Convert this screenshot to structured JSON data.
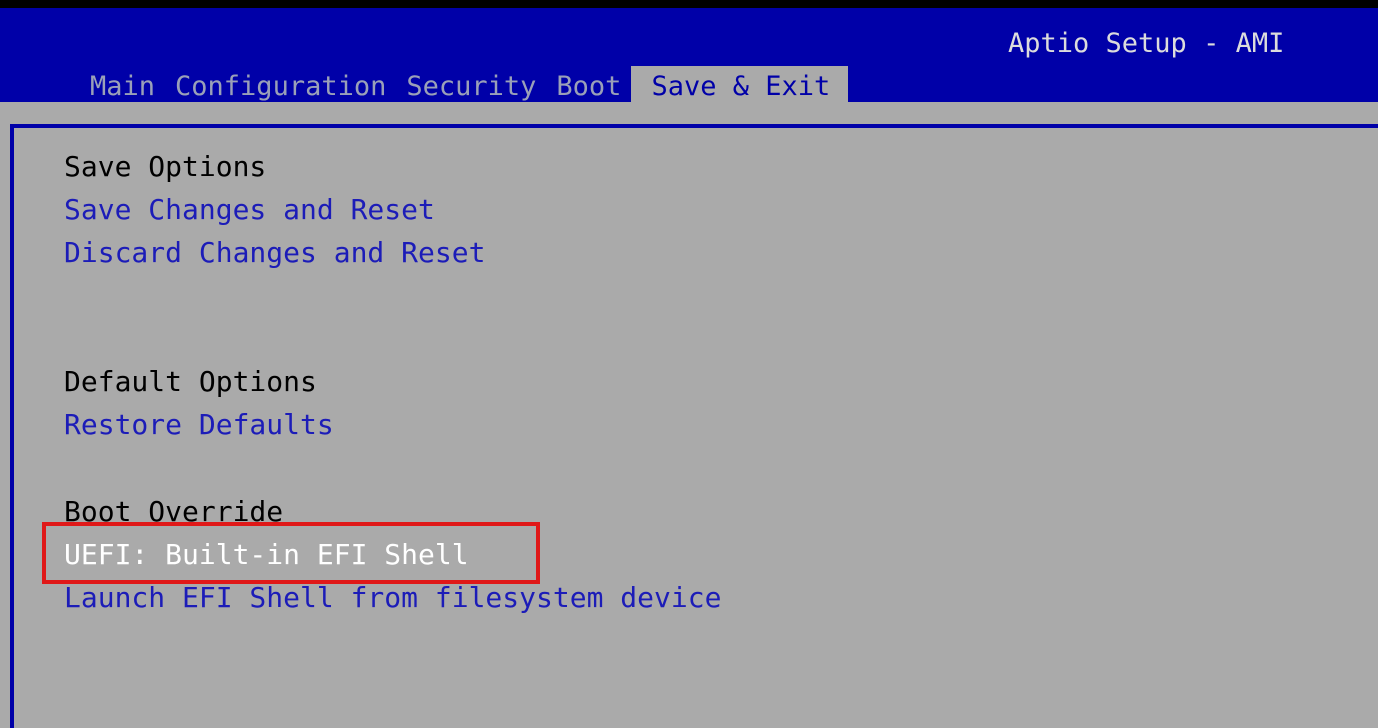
{
  "header": {
    "title": "Aptio Setup - AMI",
    "tabs": [
      {
        "label": "Main"
      },
      {
        "label": "Configuration"
      },
      {
        "label": "Security"
      },
      {
        "label": "Boot"
      },
      {
        "label": "Save & Exit"
      }
    ],
    "active_tab": "Save & Exit"
  },
  "menu": {
    "save_options_heading": "Save Options",
    "save_changes_reset": "Save Changes and Reset",
    "discard_changes_reset": "Discard Changes and Reset",
    "default_options_heading": "Default Options",
    "restore_defaults": "Restore Defaults",
    "boot_override_heading": "Boot Override",
    "uefi_shell": "UEFI: Built-in EFI Shell",
    "launch_efi_shell": "Launch EFI Shell from filesystem device"
  },
  "colors": {
    "header_bg": "#0000a8",
    "panel_bg": "#aaaaaa",
    "link_text": "#1c1cb8",
    "selected_text": "#ffffff",
    "annotation_box": "#e01818"
  }
}
